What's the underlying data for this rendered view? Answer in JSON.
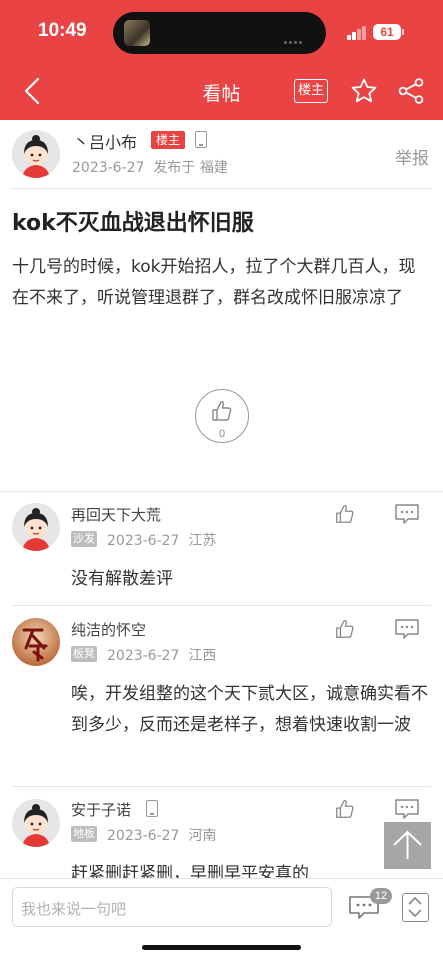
{
  "status_bar": {
    "time": "10:49",
    "battery": "61"
  },
  "nav": {
    "title": "看帖",
    "op_only_label": "楼主"
  },
  "post": {
    "author": "丶吕小布",
    "op_badge": "楼主",
    "date": "2023-6-27",
    "published_at": "发布于 福建",
    "report_label": "举报",
    "title": "kok不灭血战退出怀旧服",
    "body": "十几号的时候，kok开始招人，拉了个大群几百人，现在不来了，听说管理退群了，群名改成怀旧服凉凉了",
    "likes": "0"
  },
  "comments": [
    {
      "name": "再回天下大荒",
      "floor": "沙发",
      "date": "2023-6-27",
      "location": "江苏",
      "text": "没有解散差评"
    },
    {
      "name": "纯洁的怀空",
      "floor": "板凳",
      "date": "2023-6-27",
      "location": "江西",
      "text": "唉，开发组整的这个天下贰大区，诚意确实看不到多少，反而还是老样子，想着快速收割一波"
    },
    {
      "name": "安于子诺",
      "floor": "地板",
      "date": "2023-6-27",
      "location": "河南",
      "text": "赶紧删赶紧删，早删早平安真的"
    }
  ],
  "bottom_bar": {
    "reply_placeholder": "我也来说一句吧",
    "comment_count": "12"
  },
  "colors": {
    "brand_red": "#e94343",
    "floor_badge": "#bdbdbd"
  }
}
